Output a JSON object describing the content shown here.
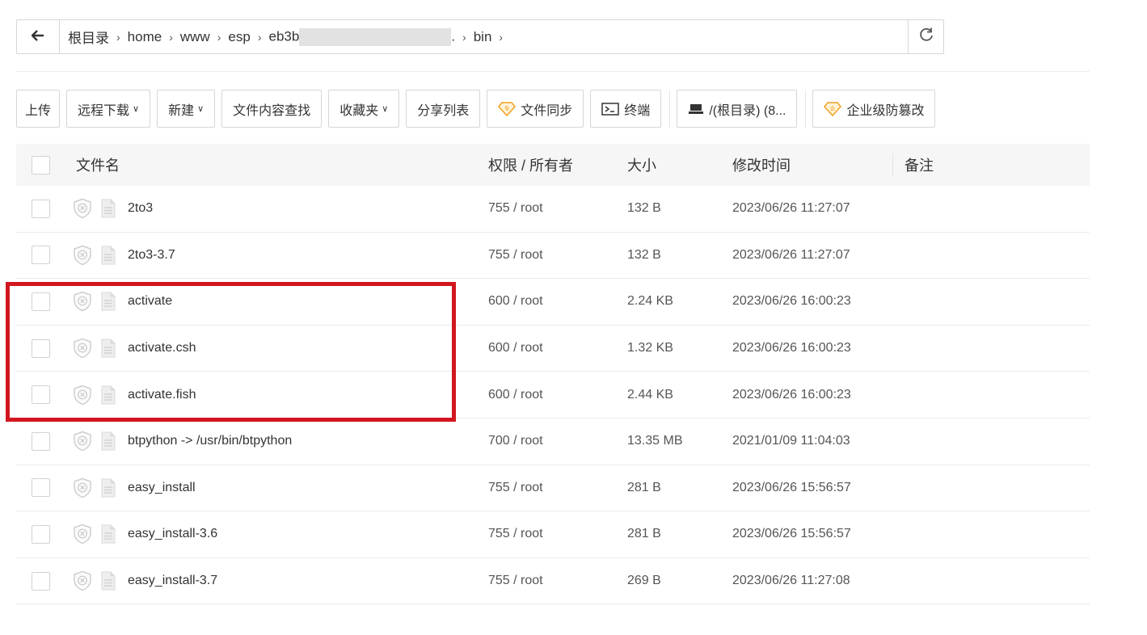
{
  "breadcrumb": {
    "back_icon": "arrow-left-icon",
    "items": [
      "根目录",
      "home",
      "www",
      "esp",
      "eb3b",
      ".",
      "bin"
    ],
    "refresh_icon": "refresh-icon"
  },
  "toolbar": {
    "upload": "上传",
    "remote_download": "远程下载",
    "new": "新建",
    "content_search": "文件内容查找",
    "favorites": "收藏夹",
    "share_list": "分享列表",
    "file_sync": "文件同步",
    "terminal": "终端",
    "disk": "/(根目录) (8...",
    "tamper_proof": "企业级防篡改"
  },
  "table": {
    "headers": {
      "name": "文件名",
      "perm": "权限 / 所有者",
      "size": "大小",
      "mtime": "修改时间",
      "note": "备注"
    },
    "rows": [
      {
        "name": "2to3",
        "perm": "755 / root",
        "size": "132 B",
        "mtime": "2023/06/26 11:27:07"
      },
      {
        "name": "2to3-3.7",
        "perm": "755 / root",
        "size": "132 B",
        "mtime": "2023/06/26 11:27:07"
      },
      {
        "name": "activate",
        "perm": "600 / root",
        "size": "2.24 KB",
        "mtime": "2023/06/26 16:00:23"
      },
      {
        "name": "activate.csh",
        "perm": "600 / root",
        "size": "1.32 KB",
        "mtime": "2023/06/26 16:00:23"
      },
      {
        "name": "activate.fish",
        "perm": "600 / root",
        "size": "2.44 KB",
        "mtime": "2023/06/26 16:00:23"
      },
      {
        "name": "btpython -> /usr/bin/btpython",
        "perm": "700 / root",
        "size": "13.35 MB",
        "mtime": "2021/01/09 11:04:03"
      },
      {
        "name": "easy_install",
        "perm": "755 / root",
        "size": "281 B",
        "mtime": "2023/06/26 15:56:57"
      },
      {
        "name": "easy_install-3.6",
        "perm": "755 / root",
        "size": "281 B",
        "mtime": "2023/06/26 15:56:57"
      },
      {
        "name": "easy_install-3.7",
        "perm": "755 / root",
        "size": "269 B",
        "mtime": "2023/06/26 11:27:08"
      }
    ]
  },
  "colors": {
    "highlight": "#d2161f",
    "accent_gold": "#f0a020"
  }
}
